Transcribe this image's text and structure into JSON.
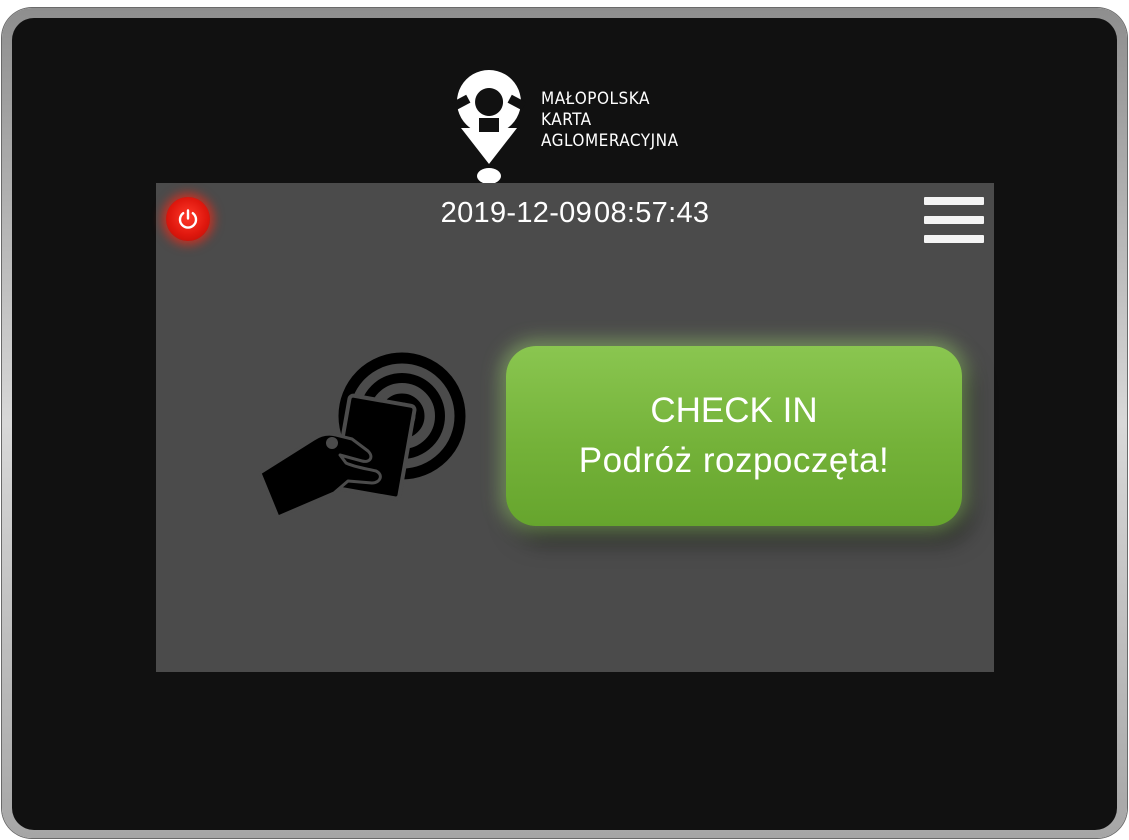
{
  "logo": {
    "lines": [
      "MAŁOPOLSKA",
      "KARTA",
      "AGLOMERACYJNA"
    ],
    "icon": "pin-logo-icon"
  },
  "status_bar": {
    "date": "2019-12-09",
    "time": "08:57:43",
    "power_icon": "power-icon",
    "menu_icon": "hamburger-menu-icon"
  },
  "main": {
    "nfc_icon": "hand-card-nfc-icon",
    "checkin": {
      "title": "CHECK IN",
      "subtitle": "Podróż rozpoczęta!"
    }
  },
  "colors": {
    "bezel": "#111111",
    "screen": "#4b4b4b",
    "power_button": "#e0180e",
    "checkin_green": "#74b239"
  }
}
